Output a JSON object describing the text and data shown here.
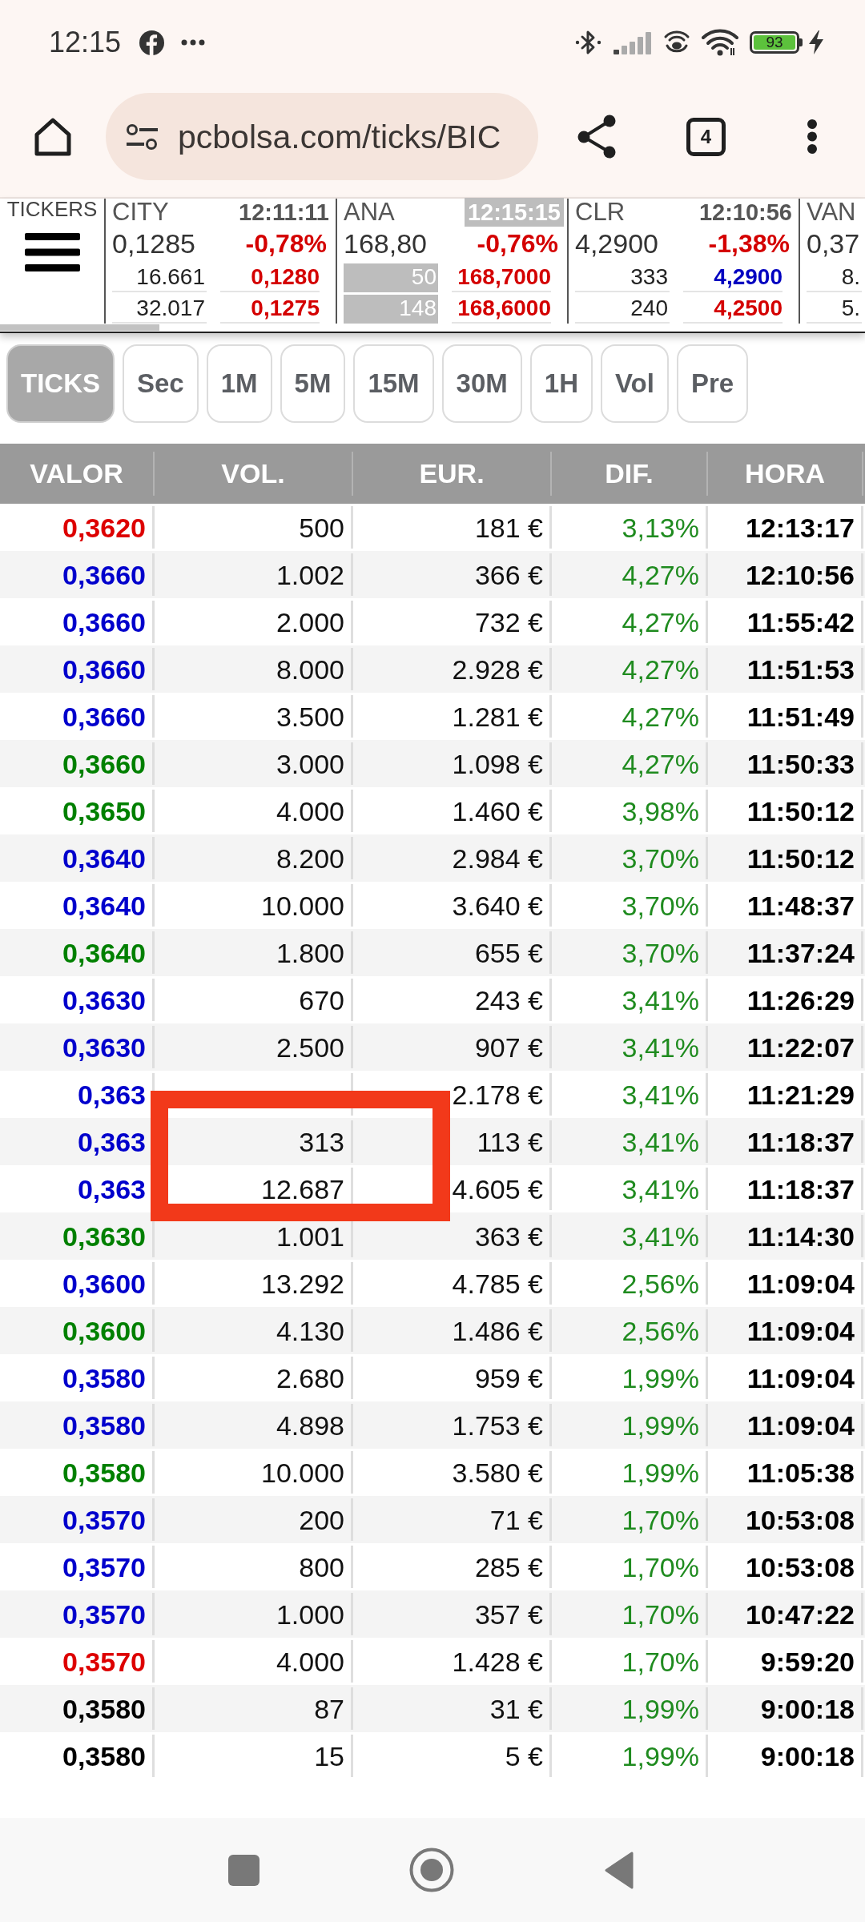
{
  "status_bar": {
    "time": "12:15",
    "battery": "93"
  },
  "browser": {
    "url": "pcbolsa.com/ticks/BIC",
    "tab_count": "4"
  },
  "tickers_panel": {
    "label": "TICKERS",
    "tickers": [
      {
        "name": "CITY",
        "time": "12:11:11",
        "time_highlighted": false,
        "price": "0,1285",
        "change": "-0,78%",
        "bids": [
          {
            "volume": "16.661",
            "highlighted": false,
            "price": "0,1280",
            "color": "#d40000"
          },
          {
            "volume": "32.017",
            "highlighted": false,
            "price": "0,1275",
            "color": "#d40000"
          }
        ]
      },
      {
        "name": "ANA",
        "time": "12:15:15",
        "time_highlighted": true,
        "price": "168,80",
        "change": "-0,76%",
        "bids": [
          {
            "volume": "50",
            "highlighted": true,
            "price": "168,7000",
            "color": "#d40000"
          },
          {
            "volume": "148",
            "highlighted": true,
            "price": "168,6000",
            "color": "#d40000"
          }
        ]
      },
      {
        "name": "CLR",
        "time": "12:10:56",
        "time_highlighted": false,
        "price": "4,2900",
        "change": "-1,38%",
        "bids": [
          {
            "volume": "333",
            "highlighted": false,
            "price": "4,2900",
            "color": "#0000c0"
          },
          {
            "volume": "240",
            "highlighted": false,
            "price": "4,2500",
            "color": "#d40000"
          }
        ]
      },
      {
        "name": "VAN",
        "price": "0,37",
        "bids": [
          {
            "volume": "8.",
            "highlighted": false
          },
          {
            "volume": "5.",
            "highlighted": false
          }
        ]
      }
    ]
  },
  "tabs": [
    {
      "label": "TICKS",
      "selected": true
    },
    {
      "label": "Sec",
      "selected": false
    },
    {
      "label": "1M",
      "selected": false
    },
    {
      "label": "5M",
      "selected": false
    },
    {
      "label": "15M",
      "selected": false
    },
    {
      "label": "30M",
      "selected": false
    },
    {
      "label": "1H",
      "selected": false
    },
    {
      "label": "Vol",
      "selected": false
    },
    {
      "label": "Pre",
      "selected": false
    }
  ],
  "table": {
    "columns": [
      "VALOR",
      "VOL.",
      "EUR.",
      "DIF.",
      "HORA"
    ],
    "rows": [
      {
        "valor": "0,3620",
        "color": "#dd0000",
        "vol": "500",
        "eur": "181 €",
        "dif": "3,13%",
        "hora": "12:13:17"
      },
      {
        "valor": "0,3660",
        "color": "#0000cc",
        "vol": "1.002",
        "eur": "366 €",
        "dif": "4,27%",
        "hora": "12:10:56"
      },
      {
        "valor": "0,3660",
        "color": "#0000cc",
        "vol": "2.000",
        "eur": "732 €",
        "dif": "4,27%",
        "hora": "11:55:42"
      },
      {
        "valor": "0,3660",
        "color": "#0000cc",
        "vol": "8.000",
        "eur": "2.928 €",
        "dif": "4,27%",
        "hora": "11:51:53"
      },
      {
        "valor": "0,3660",
        "color": "#0000cc",
        "vol": "3.500",
        "eur": "1.281 €",
        "dif": "4,27%",
        "hora": "11:51:49"
      },
      {
        "valor": "0,3660",
        "color": "#008000",
        "vol": "3.000",
        "eur": "1.098 €",
        "dif": "4,27%",
        "hora": "11:50:33"
      },
      {
        "valor": "0,3650",
        "color": "#008000",
        "vol": "4.000",
        "eur": "1.460 €",
        "dif": "3,98%",
        "hora": "11:50:12"
      },
      {
        "valor": "0,3640",
        "color": "#0000cc",
        "vol": "8.200",
        "eur": "2.984 €",
        "dif": "3,70%",
        "hora": "11:50:12"
      },
      {
        "valor": "0,3640",
        "color": "#0000cc",
        "vol": "10.000",
        "eur": "3.640 €",
        "dif": "3,70%",
        "hora": "11:48:37"
      },
      {
        "valor": "0,3640",
        "color": "#008000",
        "vol": "1.800",
        "eur": "655 €",
        "dif": "3,70%",
        "hora": "11:37:24"
      },
      {
        "valor": "0,3630",
        "color": "#0000cc",
        "vol": "670",
        "eur": "243 €",
        "dif": "3,41%",
        "hora": "11:26:29"
      },
      {
        "valor": "0,3630",
        "color": "#0000cc",
        "vol": "2.500",
        "eur": "907 €",
        "dif": "3,41%",
        "hora": "11:22:07"
      },
      {
        "valor": "0,363",
        "color": "#0000cc",
        "eur": "2.178 €",
        "dif": "3,41%",
        "hora": "11:21:29"
      },
      {
        "valor": "0,363",
        "color": "#0000cc",
        "vol": "313",
        "eur": "113 €",
        "dif": "3,41%",
        "hora": "11:18:37"
      },
      {
        "valor": "0,363",
        "color": "#0000cc",
        "vol": "12.687",
        "eur": "4.605 €",
        "dif": "3,41%",
        "hora": "11:18:37"
      },
      {
        "valor": "0,3630",
        "color": "#008000",
        "vol": "1.001",
        "eur": "363 €",
        "dif": "3,41%",
        "hora": "11:14:30"
      },
      {
        "valor": "0,3600",
        "color": "#0000cc",
        "vol": "13.292",
        "eur": "4.785 €",
        "dif": "2,56%",
        "hora": "11:09:04"
      },
      {
        "valor": "0,3600",
        "color": "#008000",
        "vol": "4.130",
        "eur": "1.486 €",
        "dif": "2,56%",
        "hora": "11:09:04"
      },
      {
        "valor": "0,3580",
        "color": "#0000cc",
        "vol": "2.680",
        "eur": "959 €",
        "dif": "1,99%",
        "hora": "11:09:04"
      },
      {
        "valor": "0,3580",
        "color": "#0000cc",
        "vol": "4.898",
        "eur": "1.753 €",
        "dif": "1,99%",
        "hora": "11:09:04"
      },
      {
        "valor": "0,3580",
        "color": "#008000",
        "vol": "10.000",
        "eur": "3.580 €",
        "dif": "1,99%",
        "hora": "11:05:38"
      },
      {
        "valor": "0,3570",
        "color": "#0000cc",
        "vol": "200",
        "eur": "71 €",
        "dif": "1,70%",
        "hora": "10:53:08"
      },
      {
        "valor": "0,3570",
        "color": "#0000cc",
        "vol": "800",
        "eur": "285 €",
        "dif": "1,70%",
        "hora": "10:53:08"
      },
      {
        "valor": "0,3570",
        "color": "#0000cc",
        "vol": "1.000",
        "eur": "357 €",
        "dif": "1,70%",
        "hora": "10:47:22"
      },
      {
        "valor": "0,3570",
        "color": "#dd0000",
        "vol": "4.000",
        "eur": "1.428 €",
        "dif": "1,70%",
        "hora": "9:59:20"
      },
      {
        "valor": "0,3580",
        "color": "#000000",
        "vol": "87",
        "eur": "31 €",
        "dif": "1,99%",
        "hora": "9:00:18"
      },
      {
        "valor": "0,3580",
        "color": "#000000",
        "vol": "15",
        "eur": "5 €",
        "dif": "1,99%",
        "hora": "9:00:18"
      }
    ]
  }
}
